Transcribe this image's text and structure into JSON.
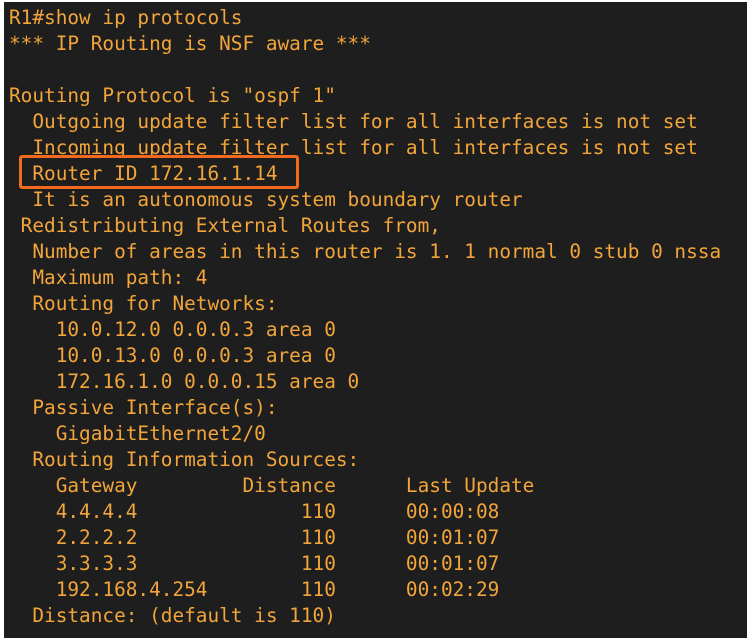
{
  "terminal": {
    "lines": [
      "R1#show ip protocols",
      "*** IP Routing is NSF aware ***",
      "",
      "Routing Protocol is \"ospf 1\"",
      "  Outgoing update filter list for all interfaces is not set",
      "  Incoming update filter list for all interfaces is not set",
      "  Router ID 172.16.1.14",
      "  It is an autonomous system boundary router",
      " Redistributing External Routes from,",
      "  Number of areas in this router is 1. 1 normal 0 stub 0 nssa",
      "  Maximum path: 4",
      "  Routing for Networks:",
      "    10.0.12.0 0.0.0.3 area 0",
      "    10.0.13.0 0.0.0.3 area 0",
      "    172.16.1.0 0.0.0.15 area 0",
      "  Passive Interface(s):",
      "    GigabitEthernet2/0",
      "  Routing Information Sources:",
      "    Gateway         Distance      Last Update",
      "    4.4.4.4              110      00:00:08",
      "    2.2.2.2              110      00:01:07",
      "    3.3.3.3              110      00:01:07",
      "    192.168.4.254        110      00:02:29",
      "  Distance: (default is 110)"
    ]
  },
  "colors": {
    "background": "#1e1e1e",
    "text": "#f2a53a",
    "highlight": "#f26a1f"
  }
}
